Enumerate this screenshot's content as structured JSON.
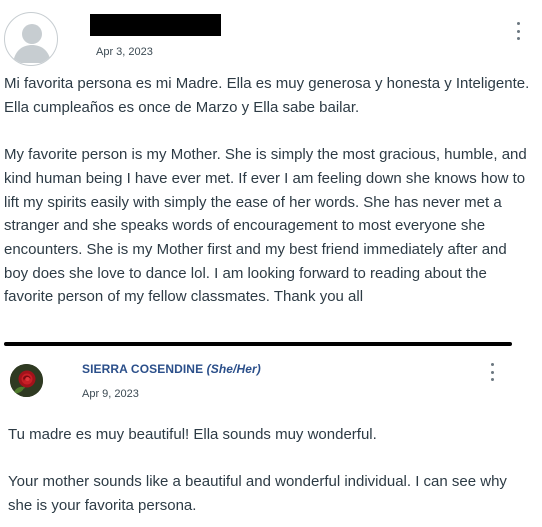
{
  "post": {
    "date": "Apr 3, 2023",
    "paragraphs": [
      "Mi favorita persona es mi Madre. Ella es muy generosa y honesta y Inteligente. Ella cumpleaños es once de Marzo y Ella sabe bailar.",
      "My favorite person is my Mother. She is simply the most gracious, humble, and kind human being I have ever met. If ever I am feeling down she knows how to lift my spirits easily with simply the ease of her words. She has never met a stranger and she speaks words of encouragement to most everyone she encounters. She is my Mother first and my best friend immediately after and boy does she love to dance lol. I am looking forward to reading about the favorite person of my fellow classmates. Thank you all"
    ],
    "avatar_icon": "default-user-avatar-icon",
    "menu_icon": "more-options-icon"
  },
  "reply": {
    "author": "SIERRA COSENDINE",
    "pronouns": "(She/Her)",
    "date": "Apr 9, 2023",
    "paragraphs": [
      "Tu madre es muy beautiful! Ella sounds muy wonderful.",
      "Your mother sounds like a beautiful and wonderful individual. I can see why she is your favorita persona."
    ],
    "avatar_icon": "red-rose-avatar-icon",
    "menu_icon": "more-options-icon",
    "author_color": "#2b4f8a"
  },
  "colors": {
    "text": "#2d3b45",
    "divider": "#000000",
    "redaction": "#000000"
  }
}
